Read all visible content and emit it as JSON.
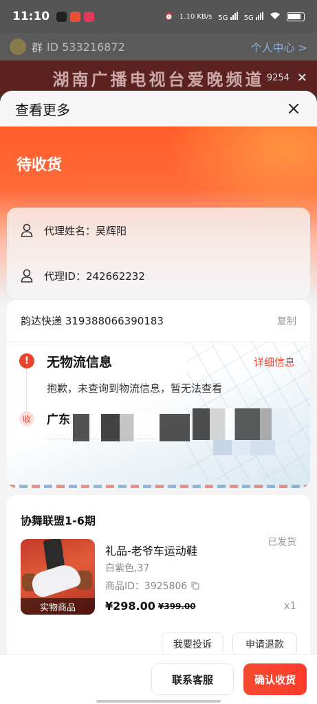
{
  "status_bar": {
    "time": "11:10",
    "net_speed": "1.10 KB/s",
    "signal1": "5G",
    "signal2": "5G",
    "battery": ""
  },
  "background": {
    "group_label": "群",
    "group_id": "ID 533216872",
    "personal_center": "个人中心 >",
    "banner_text": "湖南广播电视台爱晚频道",
    "views": "9254",
    "close": "×"
  },
  "sheet": {
    "title": "查看更多",
    "order_status": "待收货"
  },
  "agent": {
    "name_label": "代理姓名：吴辉阳",
    "id_label": "代理ID：242662232"
  },
  "logistics": {
    "carrier_tracking": "韵达快递 319388066390183",
    "copy_label": "复制",
    "warn_mark": "!",
    "no_info_title": "无物流信息",
    "detail_link": "详细信息",
    "no_info_desc": "抱歉，未查询到物流信息，暂无法查看",
    "recv_mark": "收",
    "recv_address": "广东"
  },
  "order": {
    "shop_name": "协舞联盟1-6期",
    "product_name": "礼品-老爷车运动鞋",
    "status": "已发货",
    "spec": "白紫色,37",
    "product_id": "商品ID：3925806",
    "image_tag": "实物商品",
    "price": "¥298.00",
    "original_price": "¥399.00",
    "quantity": "x1",
    "complain_label": "我要投诉",
    "refund_label": "申请退款"
  },
  "bottom": {
    "service_label": "联系客服",
    "confirm_label": "确认收货"
  },
  "colors": {
    "accent": "#E8432D",
    "hero_top": "#FF5E2A"
  }
}
